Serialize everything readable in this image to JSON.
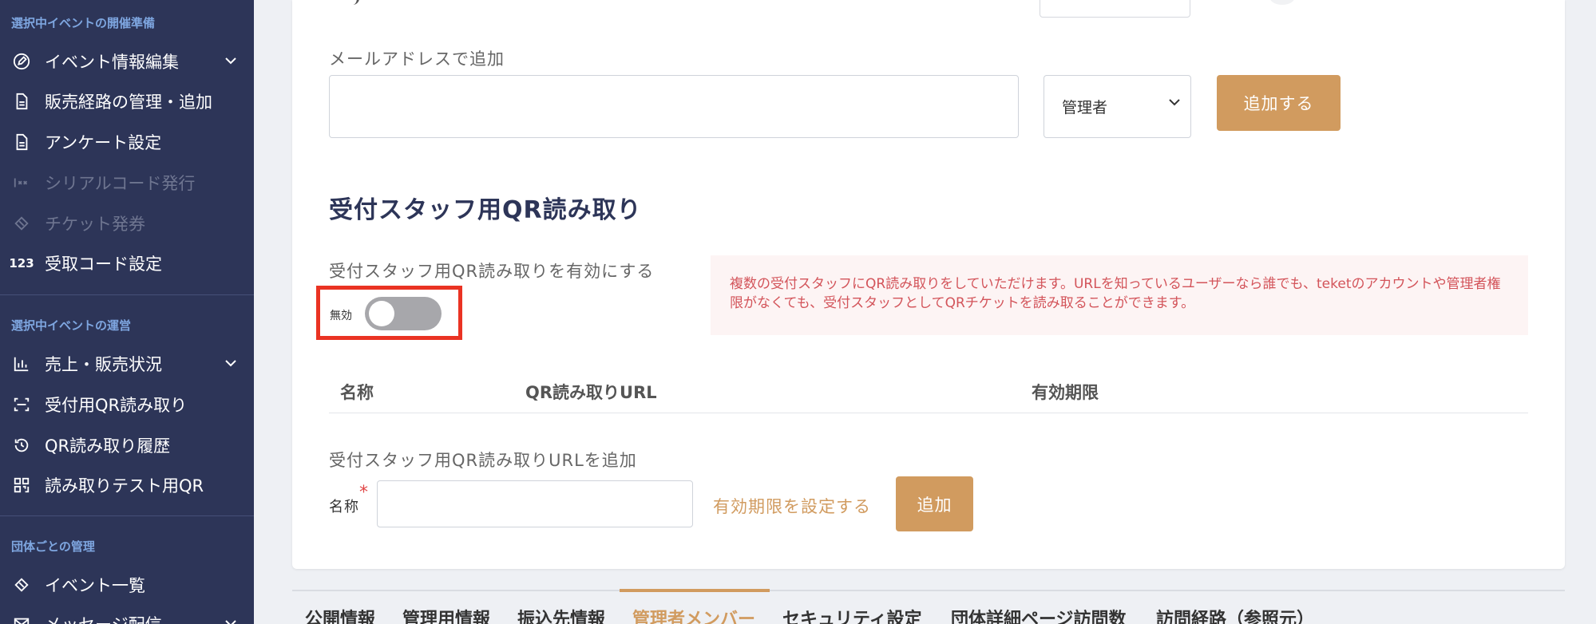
{
  "sidebar": {
    "section1": "選択中イベントの開催準備",
    "section2": "選択中イベントの運営",
    "section3": "団体ごとの管理",
    "items": [
      {
        "label": "イベント情報編集",
        "icon": "edit-icon"
      },
      {
        "label": "販売経路の管理・追加",
        "icon": "document-icon"
      },
      {
        "label": "アンケート設定",
        "icon": "document-icon"
      },
      {
        "label": "シリアルコード発行",
        "icon": "serial-icon"
      },
      {
        "label": "チケット発券",
        "icon": "ticket-icon"
      },
      {
        "label": "受取コード設定",
        "icon": "number-icon",
        "icon_text": "123"
      },
      {
        "label": "売上・販売状況",
        "icon": "bar-chart-icon"
      },
      {
        "label": "受付用QR読み取り",
        "icon": "scan-icon"
      },
      {
        "label": "QR読み取り履歴",
        "icon": "history-icon"
      },
      {
        "label": "読み取りテスト用QR",
        "icon": "qr-icon"
      },
      {
        "label": "イベント一覧",
        "icon": "ticket-icon"
      },
      {
        "label": "メッセージ配信",
        "icon": "mail-icon"
      }
    ]
  },
  "main": {
    "email_add_label": "メールアドレスで追加",
    "email_value": "",
    "role_select": "管理者",
    "add_button": "追加する",
    "qr_heading": "受付スタッフ用QR読み取り",
    "enable_label": "受付スタッフ用QR読み取りを有効にする",
    "toggle_state": "無効",
    "notice_text": "複数の受付スタッフにQR読み取りをしていただけます。URLを知っているユーザーなら誰でも、teketのアカウントや管理者権限がなくても、受付スタッフとしてQRチケットを読み取ることができます。",
    "table_headers": [
      "名称",
      "QR読み取りURL",
      "有効期限"
    ],
    "add_url_label": "受付スタッフ用QR読み取りURLを追加",
    "name_label": "名称",
    "required_mark": "*",
    "name_value": "",
    "set_expiry_link": "有効期限を設定する",
    "add_small_button": "追加"
  },
  "tabs": [
    "公開情報",
    "管理用情報",
    "振込先情報",
    "管理者メンバー",
    "セキュリティ設定",
    "団体詳細ページ訪問数",
    "訪問経路（参照元）"
  ],
  "active_tab": "管理者メンバー",
  "colors": {
    "sidebar_bg": "#2d3558",
    "accent": "#d19b5f",
    "highlight": "#ea3323",
    "notice": "#d3545a"
  }
}
